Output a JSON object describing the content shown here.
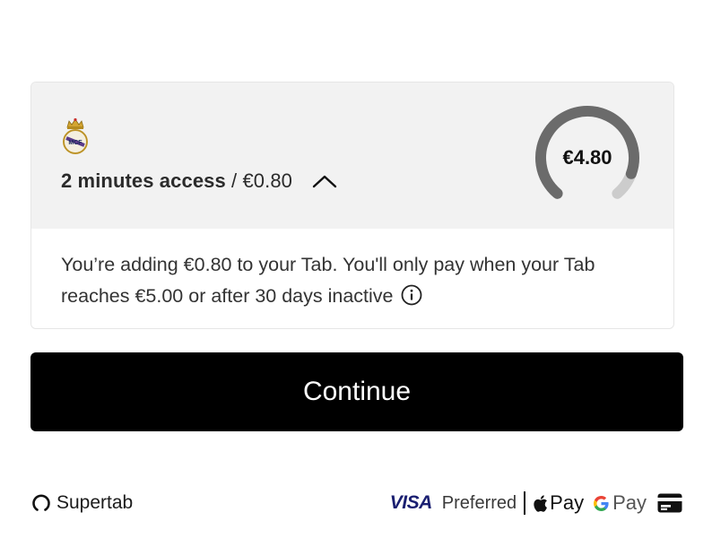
{
  "offer": {
    "duration": "2 minutes access",
    "separator": " / ",
    "price": "€0.80"
  },
  "tab": {
    "total": "€4.80",
    "limit": "€5.00",
    "fill_fraction": 0.96
  },
  "info": {
    "text": "You’re adding €0.80 to your Tab. You'll only pay when your Tab reaches €5.00 or after 30 days inactive"
  },
  "cta": {
    "label": "Continue"
  },
  "footer": {
    "brand": "Supertab",
    "visa": "VISA",
    "preferred": "Preferred",
    "apple_pay": "Pay",
    "google_pay": "Pay"
  },
  "icons": {
    "crest": "publisher-crest-icon",
    "chevron": "chevron-up-icon",
    "info": "info-icon",
    "supertab": "supertab-logo-icon",
    "apple": "apple-icon",
    "google": "google-g-icon",
    "card": "credit-card-icon"
  },
  "colors": {
    "panel": "#f2f2f2",
    "gauge_track": "#cccccc",
    "gauge_fill": "#6b6b6b",
    "button_bg": "#000000",
    "visa_blue": "#1a1f71"
  }
}
